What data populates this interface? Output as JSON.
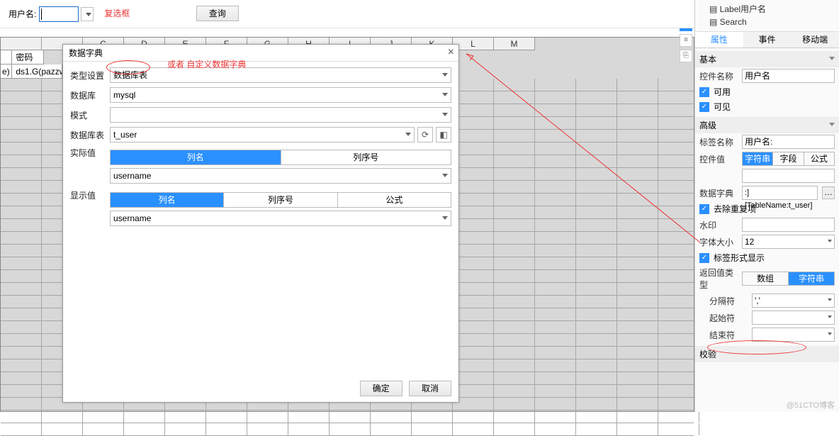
{
  "topbar": {
    "username_lbl": "用户名:",
    "checkbox_note": "复选框",
    "query_btn": "查询"
  },
  "grid": {
    "cols": [
      "",
      "",
      "C",
      "D",
      "E",
      "F",
      "G",
      "H",
      "I",
      "J",
      "K",
      "L",
      "M"
    ],
    "row0": {
      "c1": "密码"
    },
    "row1": {
      "c0": "e)",
      "c1": "ds1.G(pazzw"
    }
  },
  "dialog": {
    "title": "数据字典",
    "annot": "或者  自定义数据字典",
    "type_lbl": "类型设置",
    "type_val": "数据库表",
    "db_lbl": "数据库",
    "db_val": "mysql",
    "mode_lbl": "模式",
    "mode_val": "",
    "table_lbl": "数据库表",
    "table_val": "t_user",
    "real_lbl": "实际值",
    "real_tabs": [
      "列名",
      "列序号"
    ],
    "real_val": "username",
    "disp_lbl": "显示值",
    "disp_tabs": [
      "列名",
      "列序号",
      "公式"
    ],
    "disp_val": "username",
    "ok": "确定",
    "cancel": "取消"
  },
  "tree": {
    "item1": "Label用户名",
    "item2": "Search"
  },
  "rp_tabs": [
    "属性",
    "事件",
    "移动端"
  ],
  "rp": {
    "basic": "基本",
    "name_lbl": "控件名称",
    "name_val": "用户名",
    "enable": "可用",
    "visible": "可见",
    "adv": "高级",
    "tag_lbl": "标签名称",
    "tag_val": "用户名:",
    "ctrl_lbl": "控件值",
    "ctrl_seg": [
      "字符串",
      "字段",
      "公式"
    ],
    "dict_lbl": "数据字典",
    "dict_val": ":][TableName:t_user]",
    "dedup": "去除重复项",
    "wm_lbl": "水印",
    "fs_lbl": "字体大小",
    "fs_val": "12",
    "tagform": "标签形式显示",
    "ret_lbl": "返回值类型",
    "ret_seg": [
      "数组",
      "字符串"
    ],
    "sep_lbl": "分隔符",
    "sep_val": "','",
    "start_lbl": "起始符",
    "end_lbl": "结束符",
    "valid_lbl": "校验"
  },
  "wm": "@51CTO博客"
}
